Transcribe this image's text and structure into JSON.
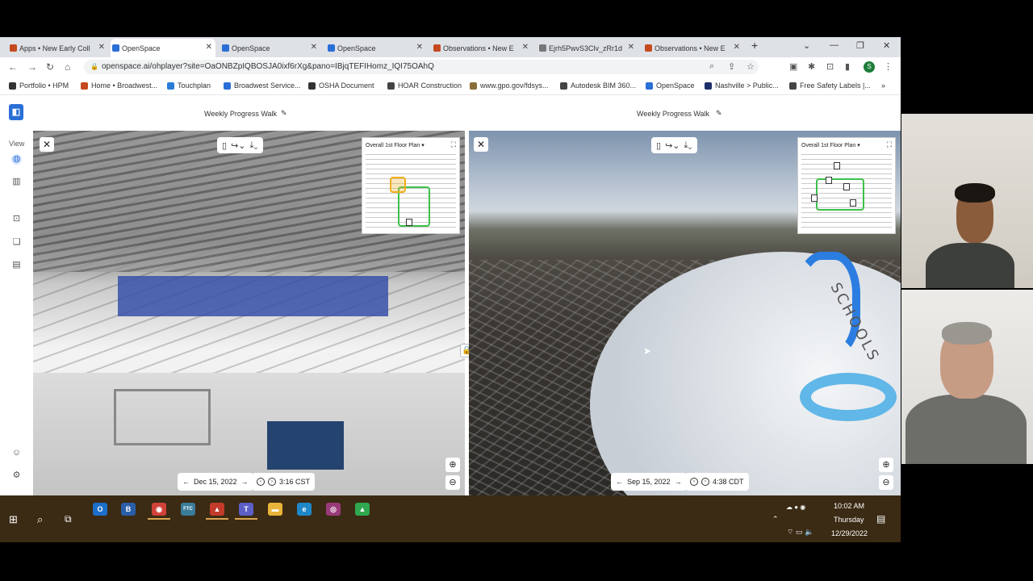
{
  "browser": {
    "tabs": [
      {
        "title": "Apps • New Early Coll",
        "color": "#c64a1f"
      },
      {
        "title": "OpenSpace",
        "color": "#2a6fd6"
      },
      {
        "title": "OpenSpace",
        "color": "#2a6fd6"
      },
      {
        "title": "OpenSpace",
        "color": "#2a6fd6"
      },
      {
        "title": "Observations • New E",
        "color": "#c64a1f"
      },
      {
        "title": "Ejrh5PwvS3Clv_zRr1d",
        "color": "#777777"
      },
      {
        "title": "Observations • New E",
        "color": "#c64a1f"
      }
    ],
    "new_tab": "+",
    "url": "openspace.ai/ohplayer?site=OaONBZpIQBOSJA0ixf6rXg&pano=IBjqTEFIHomz_IQI75OAhQ",
    "profile_initial": "S",
    "bookmarks": [
      {
        "label": "Portfolio • HPM",
        "color": "#333333"
      },
      {
        "label": "Home • Broadwest...",
        "color": "#c64a1f"
      },
      {
        "label": "Touchplan",
        "color": "#2a7bd6"
      },
      {
        "label": "Broadwest Service...",
        "color": "#2a6fd6"
      },
      {
        "label": "OSHA Document",
        "color": "#333333"
      },
      {
        "label": "HOAR Construction",
        "color": "#444444"
      },
      {
        "label": "www.gpo.gov/fdsys...",
        "color": "#8b6f3a"
      },
      {
        "label": "Autodesk BIM 360...",
        "color": "#444444"
      },
      {
        "label": "OpenSpace",
        "color": "#2a6fd6"
      },
      {
        "label": "Nashville > Public...",
        "color": "#1d2f6b"
      },
      {
        "label": "Free Safety Labels |...",
        "color": "#444444"
      }
    ],
    "bookmarks_more": "»"
  },
  "app": {
    "left": {
      "title": "Weekly Progress Walk",
      "floor_plan": "Overall 1st Floor Plan",
      "date": "Dec 15, 2022",
      "time": "3:16 CST"
    },
    "right": {
      "title": "Weekly Progress Walk",
      "floor_plan": "Overall 1st Floor Plan",
      "date": "Sep 15, 2022",
      "time": "4:38 CDT",
      "camera_text": "SCHOOLS"
    },
    "rail": {
      "view_label": "View"
    }
  },
  "taskbar": {
    "apps": [
      {
        "name": "outlook",
        "glyph": "O",
        "color": "#1c6fc9"
      },
      {
        "name": "app-b",
        "glyph": "B",
        "color": "#2a5ea8"
      },
      {
        "name": "chrome",
        "glyph": "◉",
        "color": "#d1433a"
      },
      {
        "name": "ftc",
        "glyph": "FTC",
        "color": "#3a7c9a"
      },
      {
        "name": "app-red",
        "glyph": "▲",
        "color": "#c33b2a"
      },
      {
        "name": "teams",
        "glyph": "T",
        "color": "#5b5fc7"
      },
      {
        "name": "file-explorer",
        "glyph": "▬",
        "color": "#e8b53a"
      },
      {
        "name": "edge",
        "glyph": "e",
        "color": "#1f88c9"
      },
      {
        "name": "app-circle",
        "glyph": "◎",
        "color": "#9b3a7b"
      },
      {
        "name": "google-drive",
        "glyph": "▲",
        "color": "#2fa84f"
      }
    ],
    "time": "10:02 AM",
    "day": "Thursday",
    "date": "12/29/2022"
  }
}
